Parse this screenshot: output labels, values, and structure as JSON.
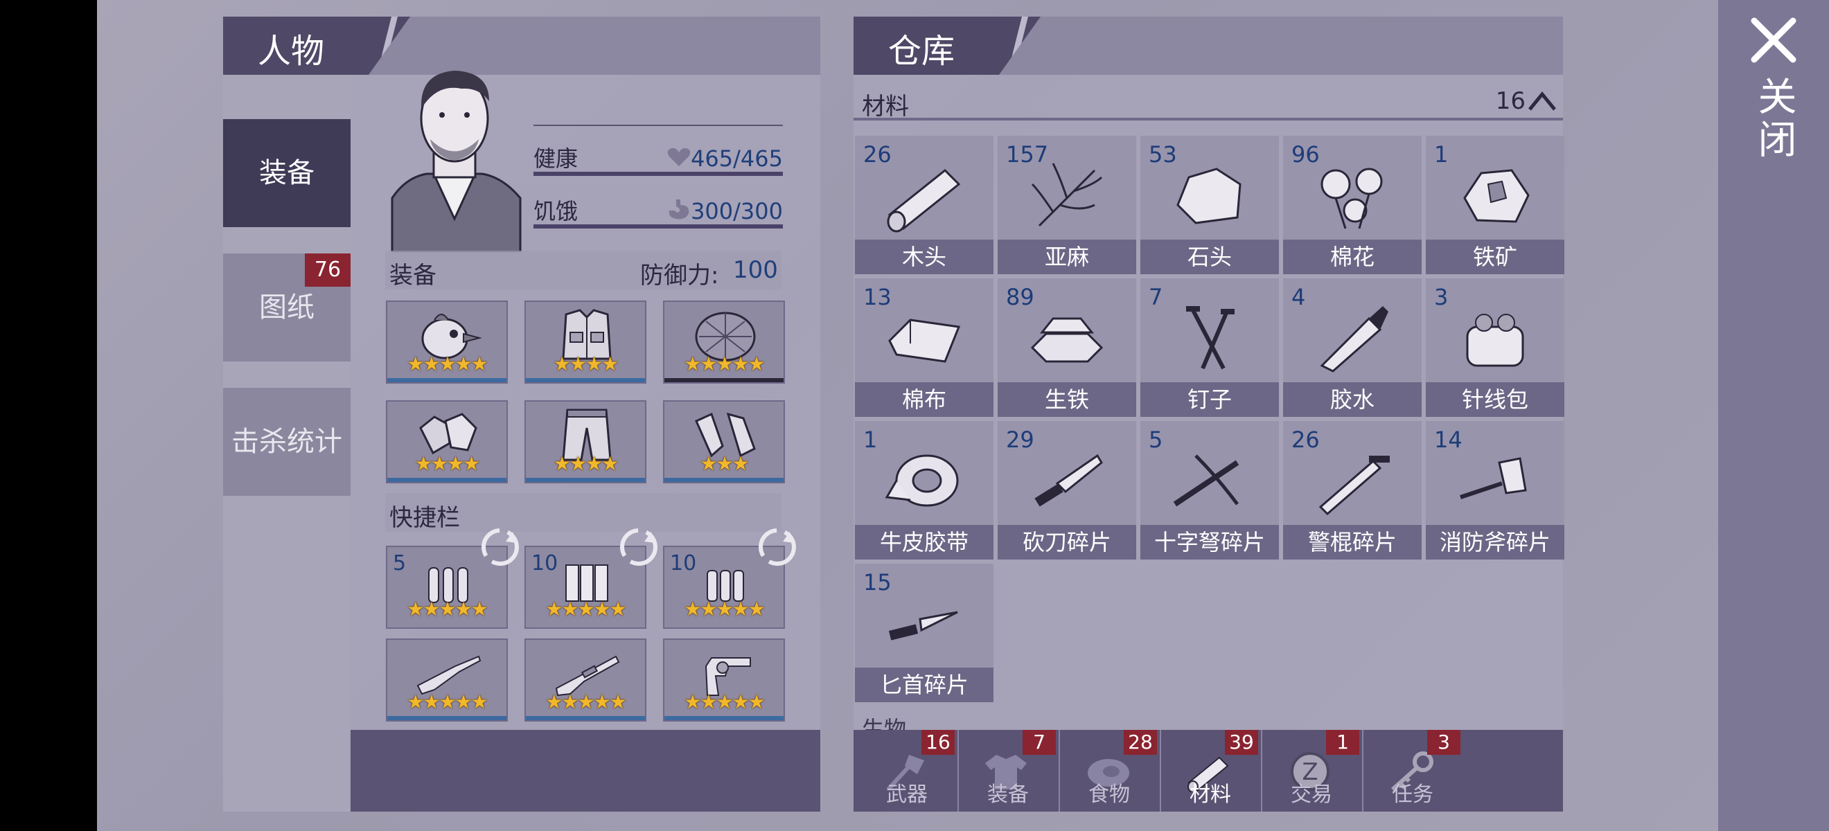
{
  "close": {
    "label": "关闭"
  },
  "character": {
    "title": "人物",
    "side_tabs": [
      {
        "label": "装备"
      },
      {
        "label": "图纸",
        "badge": "76"
      },
      {
        "label": "击杀统计"
      }
    ],
    "stats": {
      "health_label": "健康",
      "health_value": "465/465",
      "hunger_label": "饥饿",
      "hunger_value": "300/300"
    },
    "equipment": {
      "label": "装备",
      "defense_label": "防御力:",
      "defense_value": "100",
      "slots": [
        {
          "icon": "chicken-helmet-icon",
          "stars": "★★★★★"
        },
        {
          "icon": "armor-vest-icon",
          "stars": "★★★★"
        },
        {
          "icon": "turtle-shell-icon",
          "stars": "★★★★★"
        },
        {
          "icon": "gloves-icon",
          "stars": "★★★★"
        },
        {
          "icon": "pants-icon",
          "stars": "★★★★"
        },
        {
          "icon": "boots-icon",
          "stars": "★★★"
        }
      ]
    },
    "quickbar": {
      "label": "快捷栏",
      "slots": [
        {
          "qty": "5",
          "icon": "rifle-ammo-icon",
          "stars": "★★★★★"
        },
        {
          "qty": "10",
          "icon": "shotgun-shells-icon",
          "stars": "★★★★★"
        },
        {
          "qty": "10",
          "icon": "pistol-ammo-icon",
          "stars": "★★★★★"
        },
        {
          "qty": "",
          "icon": "rifle-icon",
          "stars": "★★★★★"
        },
        {
          "qty": "",
          "icon": "shotgun-icon",
          "stars": "★★★★★"
        },
        {
          "qty": "",
          "icon": "revolver-icon",
          "stars": "★★★★★"
        }
      ]
    }
  },
  "warehouse": {
    "title": "仓库",
    "section": {
      "label": "材料",
      "count": "16"
    },
    "next_section_label": "生物",
    "items": [
      {
        "name": "木头",
        "qty": "26",
        "icon": "log-icon"
      },
      {
        "name": "亚麻",
        "qty": "157",
        "icon": "flax-icon"
      },
      {
        "name": "石头",
        "qty": "53",
        "icon": "stone-icon"
      },
      {
        "name": "棉花",
        "qty": "96",
        "icon": "cotton-icon"
      },
      {
        "name": "铁矿",
        "qty": "1",
        "icon": "iron-ore-icon"
      },
      {
        "name": "棉布",
        "qty": "13",
        "icon": "cloth-icon"
      },
      {
        "name": "生铁",
        "qty": "89",
        "icon": "iron-ingot-icon"
      },
      {
        "name": "钉子",
        "qty": "7",
        "icon": "nails-icon"
      },
      {
        "name": "胶水",
        "qty": "4",
        "icon": "glue-icon"
      },
      {
        "name": "针线包",
        "qty": "3",
        "icon": "sewing-kit-icon"
      },
      {
        "name": "牛皮胶带",
        "qty": "1",
        "icon": "tape-icon"
      },
      {
        "name": "砍刀碎片",
        "qty": "29",
        "icon": "machete-fragment-icon"
      },
      {
        "name": "十字弩碎片",
        "qty": "5",
        "icon": "crossbow-fragment-icon"
      },
      {
        "name": "警棍碎片",
        "qty": "26",
        "icon": "baton-fragment-icon"
      },
      {
        "name": "消防斧碎片",
        "qty": "14",
        "icon": "fire-axe-fragment-icon"
      },
      {
        "name": "匕首碎片",
        "qty": "15",
        "icon": "dagger-fragment-icon"
      }
    ],
    "bottom_tabs": [
      {
        "label": "武器",
        "badge": "16",
        "icon": "axe-icon"
      },
      {
        "label": "装备",
        "badge": "7",
        "icon": "shirt-icon"
      },
      {
        "label": "食物",
        "badge": "28",
        "icon": "meat-icon"
      },
      {
        "label": "材料",
        "badge": "39",
        "icon": "log-icon",
        "active": true
      },
      {
        "label": "交易",
        "badge": "1",
        "icon": "coin-icon"
      },
      {
        "label": "任务",
        "badge": "3",
        "icon": "key-icon"
      }
    ]
  }
}
